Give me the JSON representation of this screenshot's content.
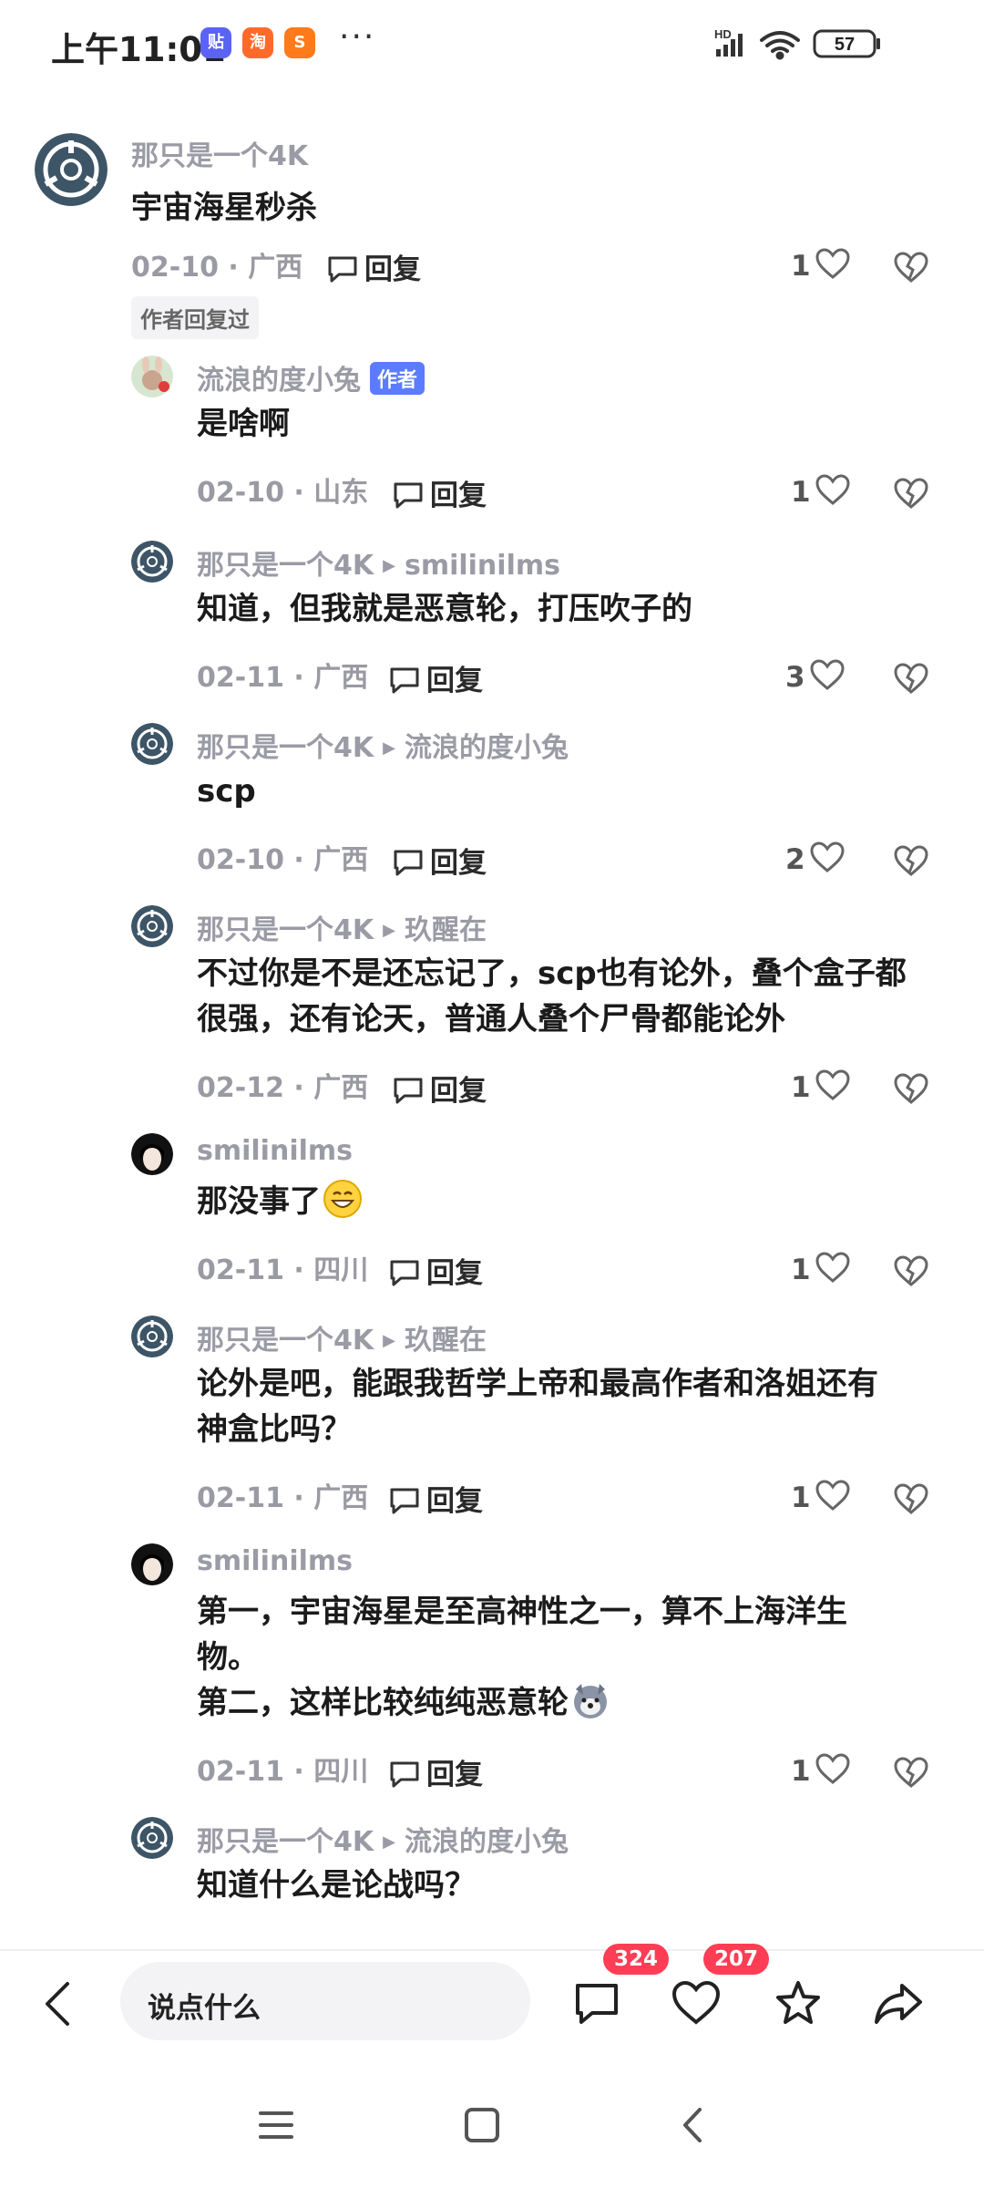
{
  "status_bar": {
    "time": "上午11:01",
    "app_icons": [
      {
        "name": "tieba-icon",
        "label": "贴",
        "color": "#5b63f5"
      },
      {
        "name": "taobao-icon",
        "label": "淘",
        "color": "#ff6a2a"
      },
      {
        "name": "app-orange-icon",
        "label": "S",
        "color": "#ff7a1a"
      }
    ],
    "more_dots": "···",
    "network": "HD",
    "battery": "57"
  },
  "comments": [
    {
      "user": "那只是一个4K",
      "reply_to": "",
      "is_author": false,
      "text": "宇宙海星秒杀",
      "date": "02-10",
      "location": "广西",
      "reply_label": "回复",
      "likes": "1",
      "author_replied": "作者回复过"
    },
    {
      "user": "流浪的度小兔",
      "reply_to": "",
      "is_author": true,
      "author_badge": "作者",
      "text": "是啥啊",
      "date": "02-10",
      "location": "山东",
      "reply_label": "回复",
      "likes": "1"
    },
    {
      "user": "那只是一个4K",
      "reply_to": "smilinilms",
      "text": "知道，但我就是恶意轮，打压吹子的",
      "date": "02-11",
      "location": "广西",
      "reply_label": "回复",
      "likes": "3"
    },
    {
      "user": "那只是一个4K",
      "reply_to": "流浪的度小兔",
      "text": "scp",
      "date": "02-10",
      "location": "广西",
      "reply_label": "回复",
      "likes": "2"
    },
    {
      "user": "那只是一个4K",
      "reply_to": "玖醒在",
      "text": "不过你是不是还忘记了，scp也有论外，叠个盒子都\n很强，还有论天，普通人叠个尸骨都能论外",
      "date": "02-12",
      "location": "广西",
      "reply_label": "回复",
      "likes": "1"
    },
    {
      "user": "smilinilms",
      "reply_to": "",
      "text": "那没事了",
      "emoji": "grinning-emoji",
      "date": "02-11",
      "location": "四川",
      "reply_label": "回复",
      "likes": "1"
    },
    {
      "user": "那只是一个4K",
      "reply_to": "玖醒在",
      "text": "论外是吧，能跟我哲学上帝和最高作者和洛姐还有\n神盒比吗？",
      "date": "02-11",
      "location": "广西",
      "reply_label": "回复",
      "likes": "1"
    },
    {
      "user": "smilinilms",
      "reply_to": "",
      "text": "第一，宇宙海星是至高神性之一，算不上海洋生\n物。\n第二，这样比较纯纯恶意轮",
      "emoji": "husky-emoji",
      "date": "02-11",
      "location": "四川",
      "reply_label": "回复",
      "likes": "1"
    },
    {
      "user": "那只是一个4K",
      "reply_to": "流浪的度小兔",
      "text": "知道什么是论战吗？"
    }
  ],
  "bottom_bar": {
    "input_placeholder": "说点什么",
    "comment_count": "324",
    "like_count": "207"
  },
  "colors": {
    "accent_badge": "#ff3d55",
    "author_badge": "#5b7cff",
    "muted_text": "#9b9ba6"
  }
}
